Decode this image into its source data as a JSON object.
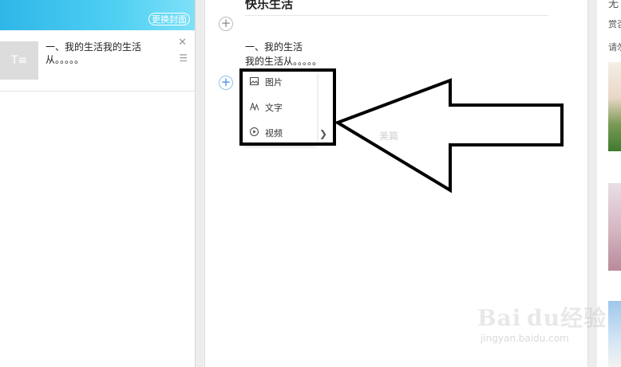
{
  "sidebar": {
    "change_cover": "更换封面",
    "section": {
      "thumb_icon": "T≡",
      "text": "一、我的生活我的生活从。。。。。",
      "close_glyph": "✕",
      "menu_glyph": "☰"
    }
  },
  "editor": {
    "title": "快乐生活",
    "paragraph_line1": "一、我的生活",
    "paragraph_line2": "我的生活从。。。。。",
    "plus_glyph": "+"
  },
  "insert_menu": {
    "items": [
      {
        "icon": "image-icon",
        "label": "图片"
      },
      {
        "icon": "text-icon",
        "label": "文字"
      },
      {
        "icon": "video-icon",
        "label": "视频"
      }
    ],
    "chevron": "❯"
  },
  "watermark": "美篇",
  "right_panel": {
    "line1": "无",
    "line2": "赏否",
    "line3": "请勿"
  },
  "baidu_watermark": {
    "logo": "Bai du经验",
    "url": "jingyan.baidu.com"
  },
  "colors": {
    "header_gradient_start": "#2fb6e8",
    "header_gradient_end": "#7fe0f8",
    "plus_active": "#3b8ee8"
  }
}
